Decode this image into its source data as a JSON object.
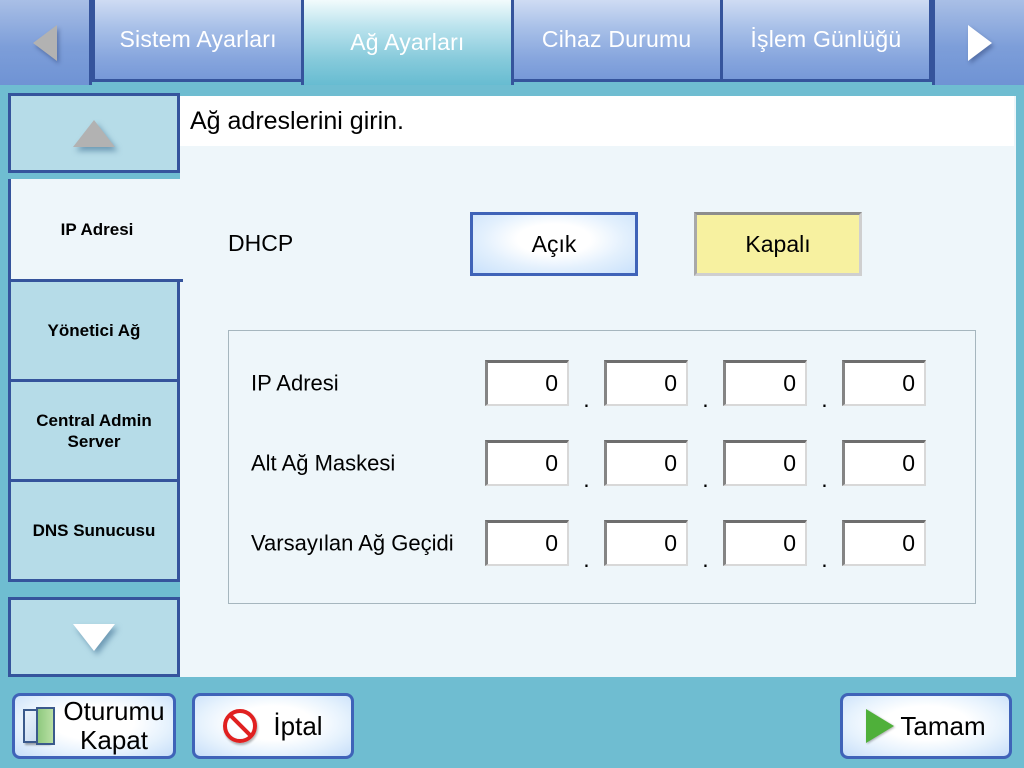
{
  "tabbar": {
    "prev_icon": "triangle-left-icon",
    "next_icon": "triangle-right-icon",
    "tabs": [
      {
        "label": "Sistem Ayarları",
        "active": false
      },
      {
        "label": "Ağ Ayarları",
        "active": true
      },
      {
        "label": "Cihaz Durumu",
        "active": false
      },
      {
        "label": "İşlem Günlüğü",
        "active": false
      }
    ]
  },
  "sidebar": {
    "scroll_up_icon": "triangle-up-icon",
    "scroll_down_icon": "triangle-down-icon",
    "items": [
      {
        "label": "IP Adresi",
        "selected": true
      },
      {
        "label": "Yönetici Ağ",
        "selected": false
      },
      {
        "label": "Central Admin Server",
        "selected": false
      },
      {
        "label": "DNS Sunucusu",
        "selected": false
      }
    ]
  },
  "content": {
    "header": "Ağ adreslerini girin.",
    "dhcp": {
      "label": "DHCP",
      "on_label": "Açık",
      "off_label": "Kapalı",
      "selected": "Kapalı"
    },
    "address_rows": [
      {
        "label": "IP Adresi",
        "octets": [
          "0",
          "0",
          "0",
          "0"
        ]
      },
      {
        "label": "Alt Ağ Maskesi",
        "octets": [
          "0",
          "0",
          "0",
          "0"
        ]
      },
      {
        "label": "Varsayılan Ağ Geçidi",
        "octets": [
          "0",
          "0",
          "0",
          "0"
        ]
      }
    ],
    "separator": "."
  },
  "footer": {
    "logout_line1": "Oturumu",
    "logout_line2": "Kapat",
    "cancel_label": "İptal",
    "ok_label": "Tamam"
  },
  "colors": {
    "app_background": "#6fbdd1",
    "tab_inactive": "#86a5dd",
    "tab_active": "#86cadb",
    "tab_border": "#35549c",
    "sidebar_item": "#b6dce8",
    "content_background": "#eef6fa",
    "selected_toggle": "#f7f1a0",
    "accent_blue": "#3f63b8"
  }
}
